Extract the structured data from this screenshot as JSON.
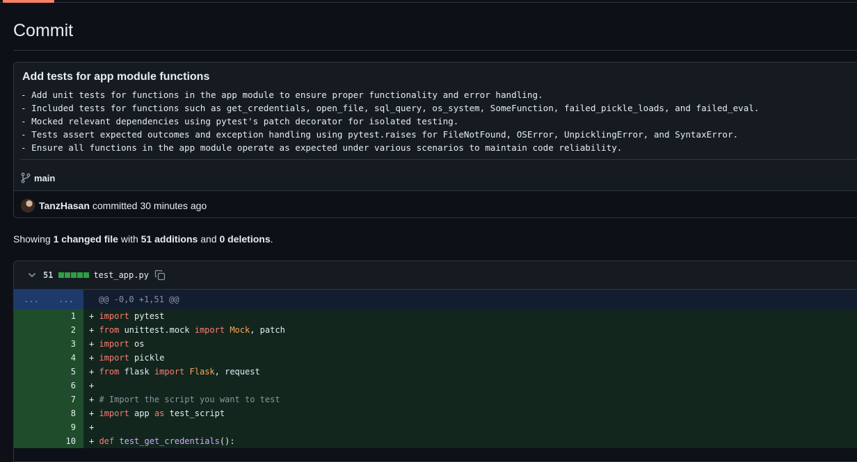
{
  "page": {
    "title": "Commit"
  },
  "commit": {
    "title": "Add tests for app module functions",
    "body_lines": [
      "- Add unit tests for functions in the app module to ensure proper functionality and error handling.",
      "- Included tests for functions such as get_credentials, open_file, sql_query, os_system, SomeFunction, failed_pickle_loads, and failed_eval.",
      "- Mocked relevant dependencies using pytest's patch decorator for isolated testing.",
      "- Tests assert expected outcomes and exception handling using pytest.raises for FileNotFound, OSError, UnpicklingError, and SyntaxError.",
      "- Ensure all functions in the app module operate as expected under various scenarios to maintain code reliability."
    ],
    "branch": "main",
    "author": "TanzHasan",
    "action": "committed",
    "time": "30 minutes ago"
  },
  "summary": {
    "prefix": "Showing ",
    "changed_files": "1 changed file",
    "with": " with ",
    "additions": "51 additions",
    "and": " and ",
    "deletions": "0 deletions",
    "suffix": "."
  },
  "file": {
    "count": "51",
    "name": "test_app.py",
    "diffstat_blocks": 5,
    "hunk": {
      "old": "...",
      "new": "...",
      "header": "@@ -0,0 +1,51 @@"
    },
    "lines": [
      {
        "n": "1",
        "segs": [
          [
            "p",
            "+ "
          ],
          [
            "kw",
            "import"
          ],
          [
            "p",
            " pytest"
          ]
        ]
      },
      {
        "n": "2",
        "segs": [
          [
            "p",
            "+ "
          ],
          [
            "kw",
            "from"
          ],
          [
            "p",
            " unittest.mock "
          ],
          [
            "kw",
            "import"
          ],
          [
            "p",
            " "
          ],
          [
            "cls",
            "Mock"
          ],
          [
            "p",
            ", patch"
          ]
        ]
      },
      {
        "n": "3",
        "segs": [
          [
            "p",
            "+ "
          ],
          [
            "kw",
            "import"
          ],
          [
            "p",
            " os"
          ]
        ]
      },
      {
        "n": "4",
        "segs": [
          [
            "p",
            "+ "
          ],
          [
            "kw",
            "import"
          ],
          [
            "p",
            " pickle"
          ]
        ]
      },
      {
        "n": "5",
        "segs": [
          [
            "p",
            "+ "
          ],
          [
            "kw",
            "from"
          ],
          [
            "p",
            " flask "
          ],
          [
            "kw",
            "import"
          ],
          [
            "p",
            " "
          ],
          [
            "cls",
            "Flask"
          ],
          [
            "p",
            ", request"
          ]
        ]
      },
      {
        "n": "6",
        "segs": [
          [
            "p",
            "+"
          ]
        ]
      },
      {
        "n": "7",
        "segs": [
          [
            "p",
            "+ "
          ],
          [
            "cm",
            "# Import the script you want to test"
          ]
        ]
      },
      {
        "n": "8",
        "segs": [
          [
            "p",
            "+ "
          ],
          [
            "kw",
            "import"
          ],
          [
            "p",
            " app "
          ],
          [
            "kw",
            "as"
          ],
          [
            "p",
            " test_script"
          ]
        ]
      },
      {
        "n": "9",
        "segs": [
          [
            "p",
            "+"
          ]
        ]
      },
      {
        "n": "10",
        "segs": [
          [
            "p",
            "+ "
          ],
          [
            "kw",
            "def"
          ],
          [
            "p",
            " "
          ],
          [
            "fn",
            "test_get_credentials"
          ],
          [
            "p",
            "():"
          ]
        ]
      }
    ]
  },
  "colors": {
    "accent": "#f78166",
    "addition": "#2ea043",
    "background": "#0d1117"
  },
  "icons": {
    "branch": "git-branch-icon",
    "chevron": "chevron-down-icon",
    "copy": "copy-icon"
  }
}
